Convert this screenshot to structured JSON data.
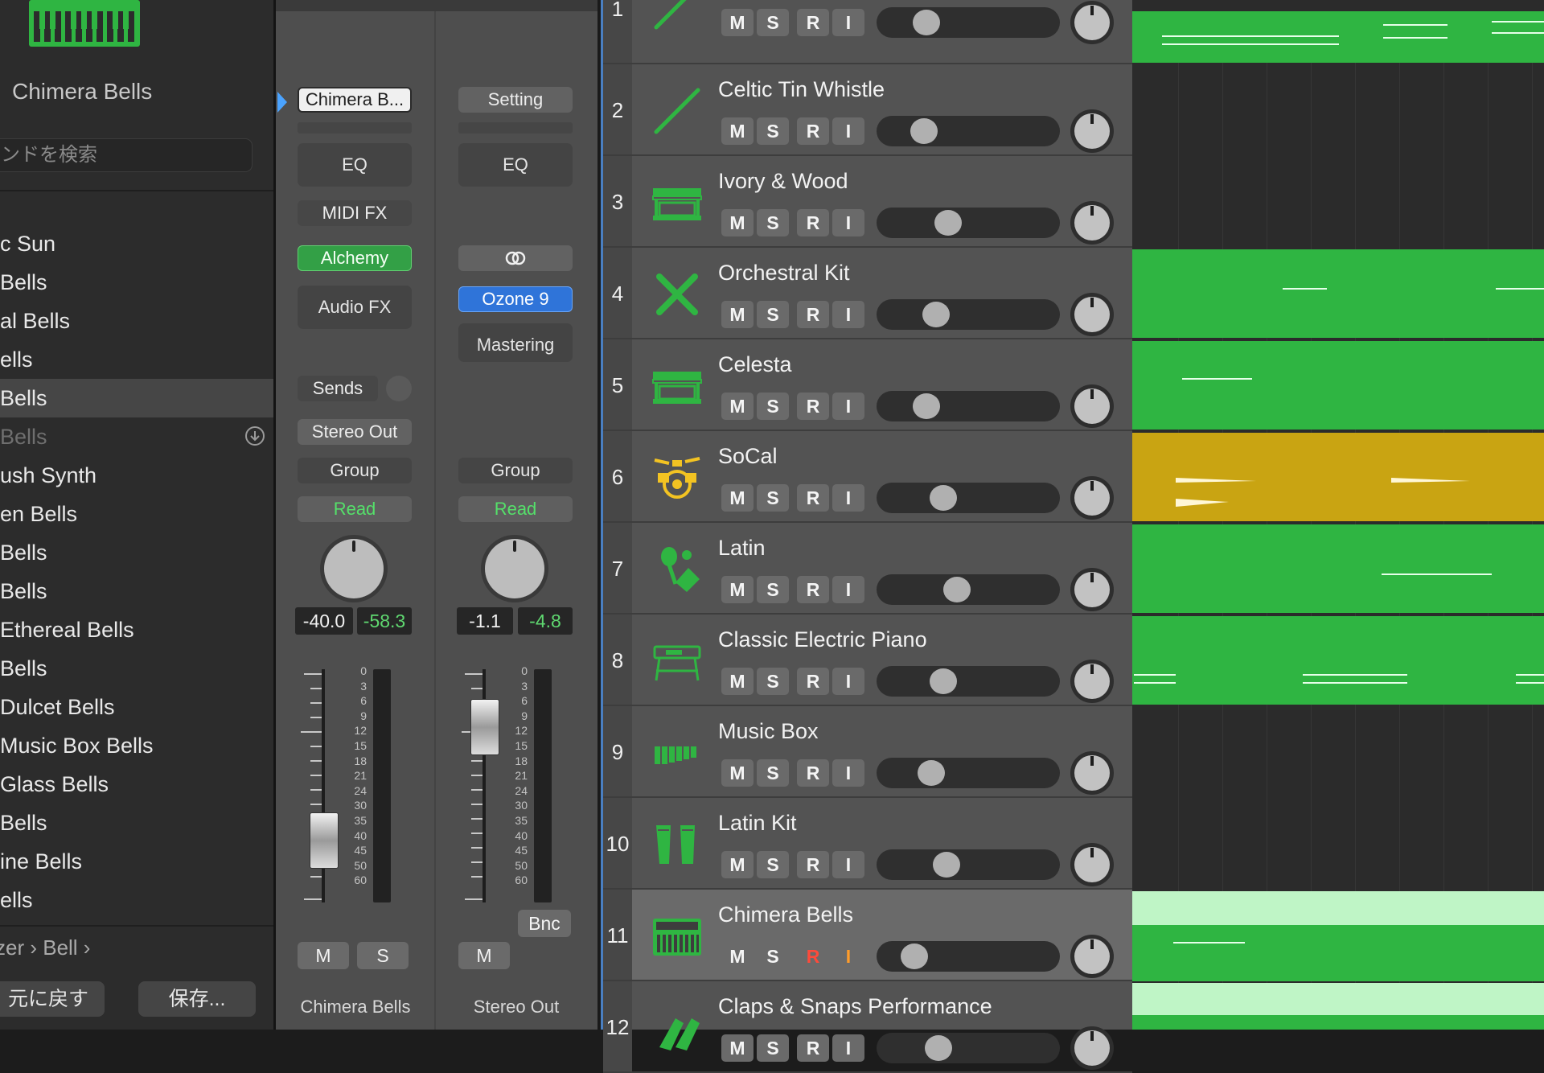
{
  "colors": {
    "accent_green": "#2fb542",
    "light_green": "#bff5c6",
    "gold": "#c9a412",
    "blue": "#2f74d9",
    "selected_border": "#4a7fc1"
  },
  "library": {
    "title": "Chimera Bells",
    "search_placeholder": "ンドを検索",
    "items": [
      {
        "label": "c Sun"
      },
      {
        "label": "Bells"
      },
      {
        "label": "al Bells"
      },
      {
        "label": "ells"
      },
      {
        "label": " Bells"
      },
      {
        "label": "Bells"
      },
      {
        "label": "ush Synth"
      },
      {
        "label": "en Bells"
      },
      {
        "label": " Bells"
      },
      {
        "label": "Bells"
      },
      {
        "label": "Ethereal Bells"
      },
      {
        "label": "Bells"
      },
      {
        "label": "Dulcet Bells"
      },
      {
        "label": "Music Box Bells"
      },
      {
        "label": " Glass Bells"
      },
      {
        "label": " Bells"
      },
      {
        "label": "ine Bells"
      },
      {
        "label": "ells"
      }
    ],
    "breadcrumb": "zer  ›  Bell  ›",
    "revert_label": "元に戻す",
    "save_label": "保存..."
  },
  "mixer": {
    "strip1": {
      "setting": "Chimera B...",
      "eq": "EQ",
      "midi_fx": "MIDI FX",
      "instrument": "Alchemy",
      "audio_fx": "Audio FX",
      "sends": "Sends",
      "output": "Stereo Out",
      "group": "Group",
      "automation": "Read",
      "volume": "-40.0",
      "peak": "-58.3",
      "mute": "M",
      "solo": "S",
      "name": "Chimera Bells",
      "fader_level": 0.19
    },
    "strip2": {
      "setting": "Setting",
      "eq": "EQ",
      "link_icon": "link-icon",
      "plugin": "Ozone 9",
      "plugin_label": "Mastering",
      "group": "Group",
      "automation": "Read",
      "volume": "-1.1",
      "peak": "-4.8",
      "mute": "M",
      "bounce": "Bnc",
      "name": "Stereo Out",
      "fader_level": 0.83
    },
    "fader_scale": [
      "0",
      "3",
      "6",
      "9",
      "12",
      "15",
      "18",
      "21",
      "24",
      "30",
      "35",
      "40",
      "45",
      "50",
      "60"
    ]
  },
  "tracks": [
    {
      "num": "1",
      "name": "",
      "icon": "tin-whistle-icon"
    },
    {
      "num": "2",
      "name": "Celtic Tin Whistle",
      "icon": "tin-whistle-icon"
    },
    {
      "num": "3",
      "name": "Ivory & Wood",
      "icon": "piano-icon"
    },
    {
      "num": "4",
      "name": "Orchestral Kit",
      "icon": "drumsticks-icon"
    },
    {
      "num": "5",
      "name": "Celesta",
      "icon": "piano-icon"
    },
    {
      "num": "6",
      "name": "SoCal",
      "icon": "drum-kit-icon"
    },
    {
      "num": "7",
      "name": "Latin",
      "icon": "maracas-icon"
    },
    {
      "num": "8",
      "name": "Classic Electric Piano",
      "icon": "electric-piano-icon"
    },
    {
      "num": "9",
      "name": "Music Box",
      "icon": "music-box-icon"
    },
    {
      "num": "10",
      "name": "Latin Kit",
      "icon": "congas-icon"
    },
    {
      "num": "11",
      "name": "Chimera Bells",
      "icon": "synth-icon"
    },
    {
      "num": "12",
      "name": "Claps & Snaps Performance",
      "icon": "claps-icon"
    }
  ],
  "track_buttons": {
    "mute": "M",
    "solo": "S",
    "record": "R",
    "input": "I"
  },
  "track_volumes": [
    0.22,
    0.2,
    0.36,
    0.28,
    0.22,
    0.33,
    0.42,
    0.33,
    0.25,
    0.35,
    0.14,
    0.3
  ]
}
